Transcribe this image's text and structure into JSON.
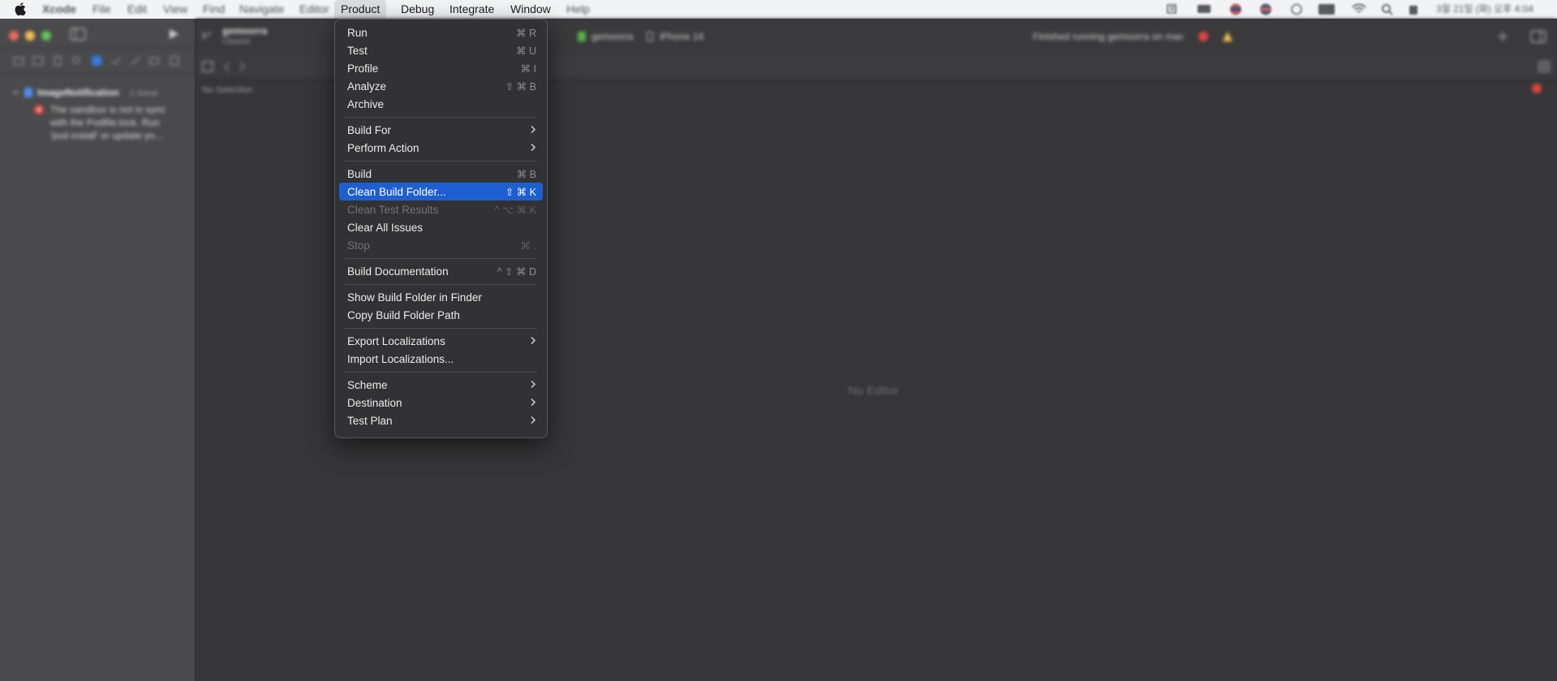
{
  "menubar": {
    "app_name": "Xcode",
    "items": [
      "File",
      "Edit",
      "View",
      "Find",
      "Navigate",
      "Editor",
      "Product",
      "Debug",
      "Integrate",
      "Window",
      "Help"
    ],
    "active_item": "Product",
    "status_icons": [
      "script-icon",
      "display-icon",
      "flag-icon",
      "flag-icon",
      "dot-icon",
      "keyboard-icon",
      "wifi-icon",
      "search-icon",
      "battery-icon"
    ],
    "clock": "3월 21일 (화) 오후 4:04"
  },
  "window": {
    "scheme_name": "gemoorra",
    "scheme_sub": "Cleaner",
    "destination_scheme": "gemoorra",
    "destination_device": "iPhone 14",
    "status_text": "Finished running gemoorra on mac",
    "sidebar": {
      "project_name": "ImageNotification",
      "issue_count": "1 issue",
      "issue_message": "The sandbox is not in sync with the Podfile.lock. Run 'pod install' or update yo..."
    },
    "editor": {
      "no_selection": "No Selection",
      "no_editor": "No Editor"
    }
  },
  "product_menu": {
    "groups": [
      [
        {
          "label": "Run",
          "shortcut": "⌘ R"
        },
        {
          "label": "Test",
          "shortcut": "⌘ U"
        },
        {
          "label": "Profile",
          "shortcut": "⌘ I"
        },
        {
          "label": "Analyze",
          "shortcut": "⇧ ⌘ B"
        },
        {
          "label": "Archive",
          "shortcut": ""
        }
      ],
      [
        {
          "label": "Build For",
          "submenu": true
        },
        {
          "label": "Perform Action",
          "submenu": true
        }
      ],
      [
        {
          "label": "Build",
          "shortcut": "⌘ B"
        },
        {
          "label": "Clean Build Folder...",
          "shortcut": "⇧ ⌘ K",
          "highlighted": true
        },
        {
          "label": "Clean Test Results",
          "shortcut": "^ ⌥ ⌘ K",
          "disabled": true
        },
        {
          "label": "Clear All Issues",
          "shortcut": ""
        },
        {
          "label": "Stop",
          "shortcut": "⌘ .",
          "disabled": true
        }
      ],
      [
        {
          "label": "Build Documentation",
          "shortcut": "^ ⇧ ⌘ D"
        }
      ],
      [
        {
          "label": "Show Build Folder in Finder",
          "shortcut": ""
        },
        {
          "label": "Copy Build Folder Path",
          "shortcut": ""
        }
      ],
      [
        {
          "label": "Export Localizations",
          "submenu": true
        },
        {
          "label": "Import Localizations...",
          "shortcut": ""
        }
      ],
      [
        {
          "label": "Scheme",
          "submenu": true
        },
        {
          "label": "Destination",
          "submenu": true
        },
        {
          "label": "Test Plan",
          "submenu": true
        }
      ]
    ]
  },
  "colors": {
    "highlight": "#1d5fd1",
    "menubar_bg": "#f2f3f5",
    "error_red": "#e0443e"
  }
}
